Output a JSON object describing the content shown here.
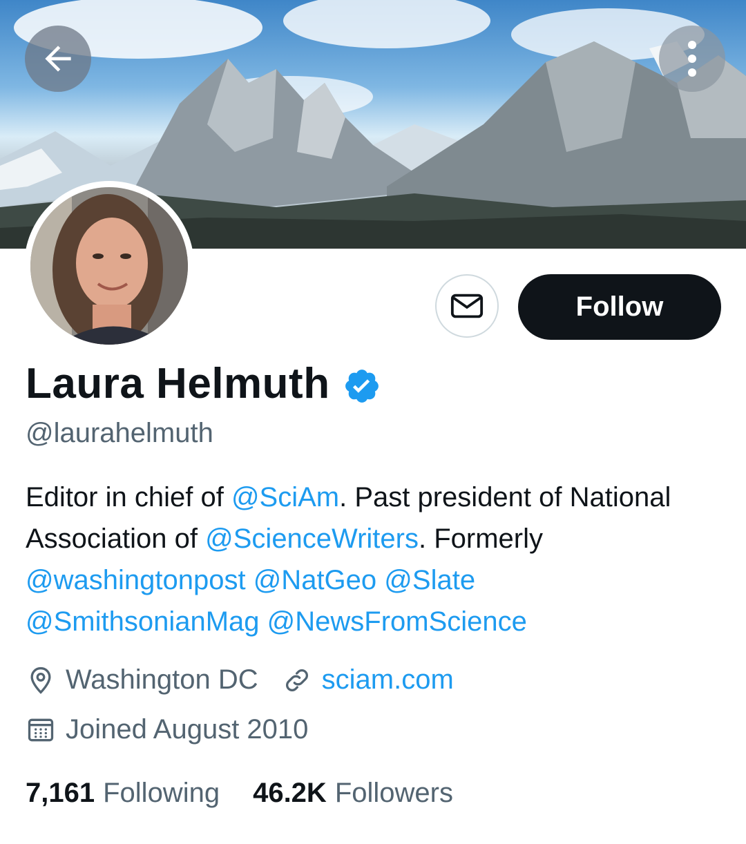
{
  "header": {
    "back_icon": "arrow-left-icon",
    "more_icon": "more-vertical-icon"
  },
  "profile": {
    "name": "Laura Helmuth",
    "verified_icon": "verified-badge-icon",
    "handle": "@laurahelmuth",
    "message_icon": "envelope-icon",
    "follow_label": "Follow",
    "bio": [
      {
        "text": "Editor in chief of ",
        "type": "text"
      },
      {
        "text": "@SciAm",
        "type": "mention"
      },
      {
        "text": ". Past president of National Association of ",
        "type": "text"
      },
      {
        "text": "@ScienceWriters",
        "type": "mention"
      },
      {
        "text": ". Formerly ",
        "type": "text"
      },
      {
        "text": "@washingtonpost",
        "type": "mention"
      },
      {
        "text": " ",
        "type": "text"
      },
      {
        "text": "@NatGeo",
        "type": "mention"
      },
      {
        "text": " ",
        "type": "text"
      },
      {
        "text": "@Slate",
        "type": "mention"
      },
      {
        "text": " ",
        "type": "text"
      },
      {
        "text": "@SmithsonianMag",
        "type": "mention"
      },
      {
        "text": " ",
        "type": "text"
      },
      {
        "text": "@NewsFromScience",
        "type": "mention"
      }
    ],
    "location": "Washington DC",
    "website": "sciam.com",
    "joined": "Joined August 2010",
    "following_count": "7,161",
    "following_label": "Following",
    "followers_count": "46.2K",
    "followers_label": "Followers"
  },
  "colors": {
    "accent": "#1d9bf0",
    "text": "#0f1419",
    "secondary": "#536471"
  }
}
